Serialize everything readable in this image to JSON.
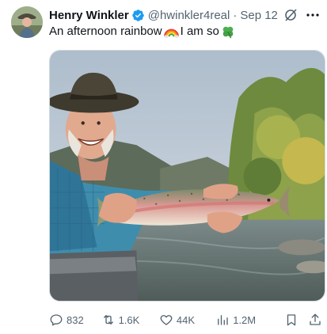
{
  "author": {
    "name": "Henry Winkler",
    "handle": "@hwinkler4real",
    "separator": "·",
    "date": "Sep 12",
    "verified_color": "#1d9bf0"
  },
  "tweet": {
    "text_part1": "An afternoon rainbow",
    "emoji1": "rainbow-emoji",
    "text_part2": "I am so",
    "emoji2": "four-leaf-clover-emoji"
  },
  "media": {
    "description_icon": "photo"
  },
  "actions": {
    "replies": "832",
    "reposts": "1.6K",
    "likes": "44K",
    "views": "1.2M"
  },
  "colors": {
    "text": "#0f1419",
    "secondary": "#536471",
    "accent": "#1d9bf0"
  }
}
